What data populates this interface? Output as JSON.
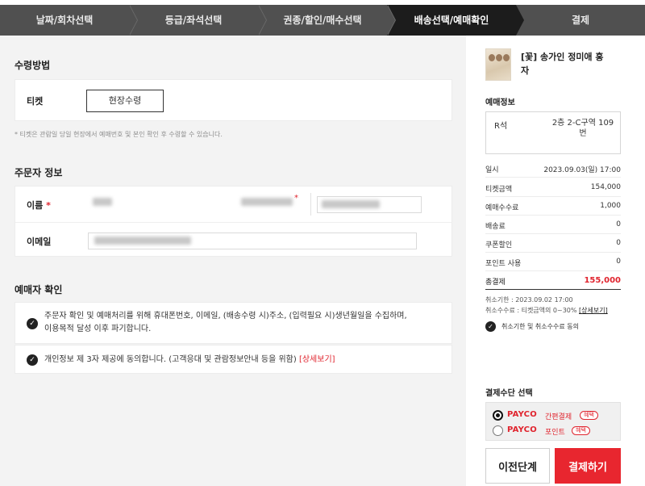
{
  "steps": [
    {
      "label": "날짜/회차선택",
      "active": false
    },
    {
      "label": "등급/좌석선택",
      "active": false
    },
    {
      "label": "권종/할인/매수선택",
      "active": false
    },
    {
      "label": "배송선택/예매확인",
      "active": true
    },
    {
      "label": "결제",
      "active": false
    }
  ],
  "receive": {
    "title": "수령방법",
    "label": "티켓",
    "method": "현장수령",
    "notice": "* 티켓은 관람일 당일 현장에서 예매번호 및 본인 확인 후 수령할 수 있습니다."
  },
  "orderer": {
    "title": "주문자 정보",
    "name_label": "이름",
    "required_mark": "*",
    "email_label": "이메일"
  },
  "confirm": {
    "title": "예매자 확인",
    "item1_line1": "주문자 확인 및 예매처리를 위해 휴대폰번호, 이메일, (배송수령 시)주소, (입력필요 시)생년월일을 수집하며,",
    "item1_line2": "이용목적 달성 이후 파기합니다.",
    "item2_text": "개인정보 제 3자 제공에 동의합니다. (고객응대 및 관람정보안내 등을 위함)",
    "item2_link": "[상세보기]"
  },
  "summary": {
    "show_title": "[꽃] 송가인 정미애 홍자",
    "booking_title": "예매정보",
    "seat_grade": "R석",
    "seat_info": "2층 2-C구역 109번",
    "rows": [
      {
        "label": "일시",
        "value": "2023.09.03(일) 17:00"
      },
      {
        "label": "티켓금액",
        "value": "154,000"
      },
      {
        "label": "예매수수료",
        "value": "1,000"
      },
      {
        "label": "배송료",
        "value": "0"
      },
      {
        "label": "쿠폰할인",
        "value": "0"
      },
      {
        "label": "포인트 사용",
        "value": "0"
      }
    ],
    "total_label": "총결제",
    "total_value": "155,000",
    "cancel_deadline": "취소기한 : 2023.09.02 17:00",
    "cancel_fee": "취소수수료 : 티켓금액의 0~30%",
    "cancel_fee_link": "[상세보기]",
    "agree_text": "취소기한 및 취소수수료 동의"
  },
  "payment": {
    "title": "결제수단 선택",
    "options": [
      {
        "brand": "PAYCO",
        "kind": "간편결제",
        "badge": "혜택",
        "selected": true
      },
      {
        "brand": "PAYCO",
        "kind": "포인트",
        "badge": "혜택",
        "selected": false
      }
    ],
    "prev_label": "이전단계",
    "pay_label": "결제하기"
  },
  "colors": {
    "accent": "#e8262f",
    "stepbar": "#505050",
    "step_active": "#1c1c1c"
  },
  "icons": {
    "check": "check-circle-icon",
    "radio": "radio-icon"
  }
}
